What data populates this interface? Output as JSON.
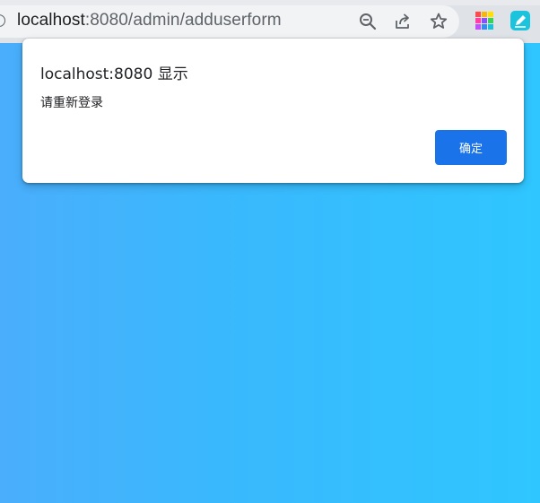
{
  "browser": {
    "url_host": "localhost",
    "url_rest": ":8080/admin/adduserform",
    "icons": [
      "site-info-icon",
      "zoom-out-icon",
      "share-icon",
      "bookmark-star-icon",
      "extension-grid-icon",
      "extension-pen-icon"
    ]
  },
  "dialog": {
    "title": "localhost:8080 显示",
    "message": "请重新登录",
    "ok_label": "确定"
  },
  "colors": {
    "toolbar": "#dfe3e7",
    "omnibox": "#f1f3f4",
    "page_gradient_start": "#4aaefc",
    "page_gradient_end": "#2fc6ff",
    "button": "#1a73e8"
  }
}
